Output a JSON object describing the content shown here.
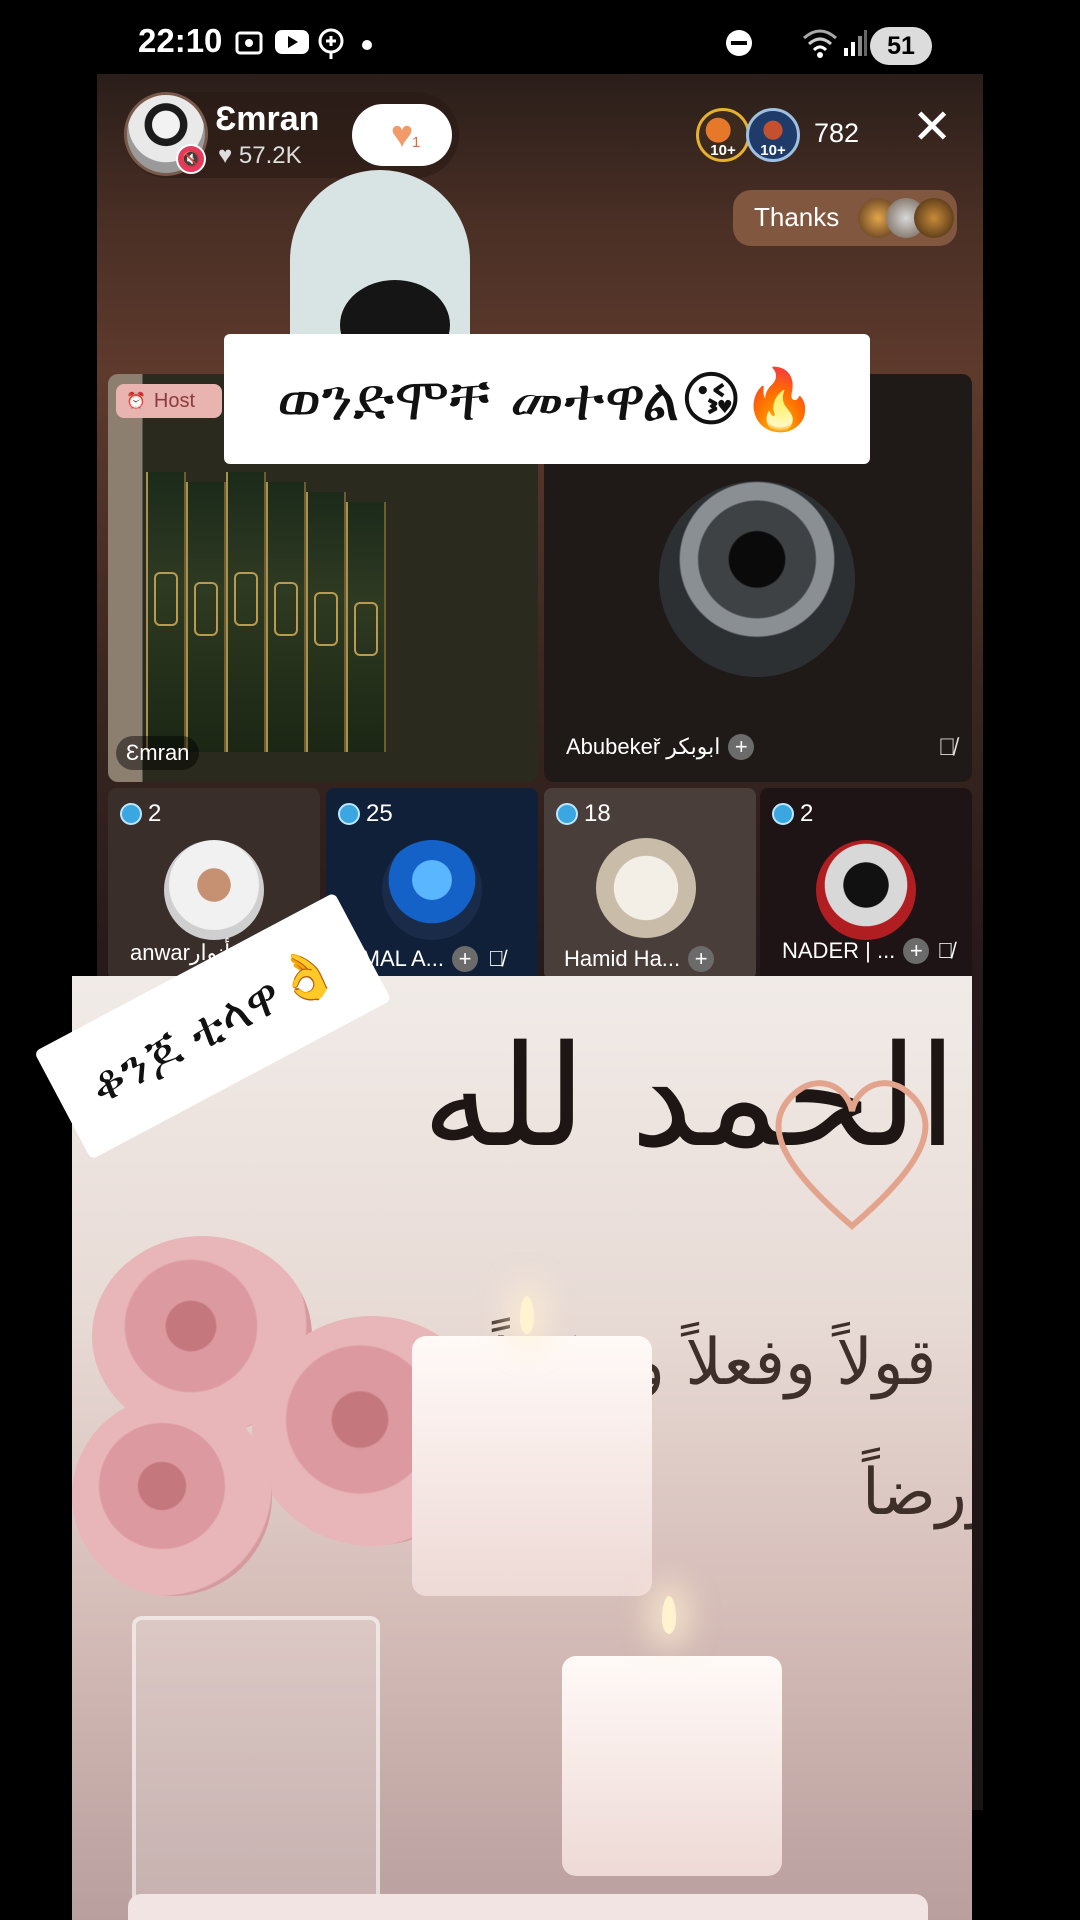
{
  "status_bar": {
    "time": "22:10",
    "battery": "51",
    "icons": [
      "screen-record-icon",
      "youtube-icon",
      "location-icon",
      "dot-icon",
      "do-not-disturb-icon",
      "wifi-icon",
      "signal-icon",
      "battery-icon"
    ]
  },
  "room": {
    "host_name": "Ɛmran",
    "host_likes": "57.2K",
    "follow_count": "1",
    "viewer_badges": [
      "10+",
      "10+"
    ],
    "viewer_count": "782",
    "thanks_label": "Thanks"
  },
  "stage": {
    "host_tag": "Host",
    "host_tile_name": "Ɛmran",
    "guest_name": "Abubekeř ابوبكر"
  },
  "seats": [
    {
      "badge": "2",
      "name": "anwarأنوار"
    },
    {
      "badge": "25",
      "name": "JEMAL A..."
    },
    {
      "badge": "18",
      "name": "Hamid Ha..."
    },
    {
      "badge": "2",
      "name": "NADER | ..."
    }
  ],
  "captions": {
    "top": "ወንድሞቸ መተዋል😘🔥",
    "tilted": "ቆንጆ ቲላዋ👌"
  },
  "overlay_image": {
    "arabic_main": "الحمد لله",
    "arabic_line1": "قولاً وفعلاً وشكراً",
    "arabic_line2": "ورضاً"
  },
  "colors": {
    "background": "#000000",
    "thanks_pill": "#82573f",
    "host_tag": "#e9b4b0",
    "gem": "#3aa7e0",
    "mute_red": "#e33a5e"
  }
}
